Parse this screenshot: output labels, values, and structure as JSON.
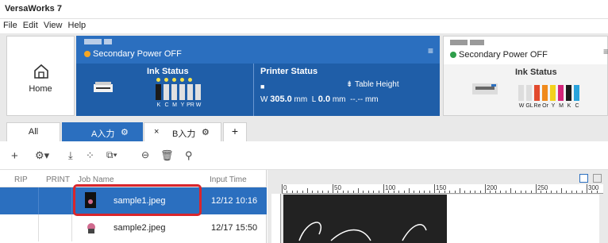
{
  "app": {
    "title": "VersaWorks 7"
  },
  "menu": [
    "File",
    "Edit",
    "View",
    "Help"
  ],
  "home": {
    "label": "Home"
  },
  "printer1": {
    "power_status": "Secondary Power OFF",
    "ink_title": "Ink Status",
    "status_title": "Printer Status",
    "table_height_label": "Table Height",
    "width_prefix": "W",
    "width_value": "305.0",
    "width_unit": "mm",
    "length_prefix": "L",
    "length_value": "0.0",
    "length_unit": "mm",
    "height_value": "--.--",
    "height_unit": "mm",
    "inks": [
      "K",
      "C",
      "M",
      "Y",
      "PR",
      "W"
    ]
  },
  "printer2": {
    "power_status": "Secondary Power OFF",
    "ink_title": "Ink Status",
    "inks": [
      "W",
      "GL",
      "Re",
      "Or",
      "Y",
      "M",
      "K",
      "C"
    ]
  },
  "tabs": {
    "all": "All",
    "a": "A入力",
    "b": "B入力",
    "close": "×",
    "add": "+"
  },
  "jobs": {
    "headers": {
      "rip": "RIP",
      "print": "PRINT",
      "name": "Job Name",
      "time": "Input Time"
    },
    "rows": [
      {
        "name": "sample1.jpeg",
        "time": "12/12 10:16"
      },
      {
        "name": "sample2.jpeg",
        "time": "12/17 15:50"
      }
    ]
  },
  "ruler": {
    "labels": [
      "0",
      "50",
      "100",
      "150",
      "200",
      "250",
      "300"
    ]
  },
  "colors": {
    "accent": "#2b6fbf",
    "highlight_box": "#d9262c",
    "power_off_p1": "#f5a623",
    "power_off_p2": "#2e9e4a"
  }
}
